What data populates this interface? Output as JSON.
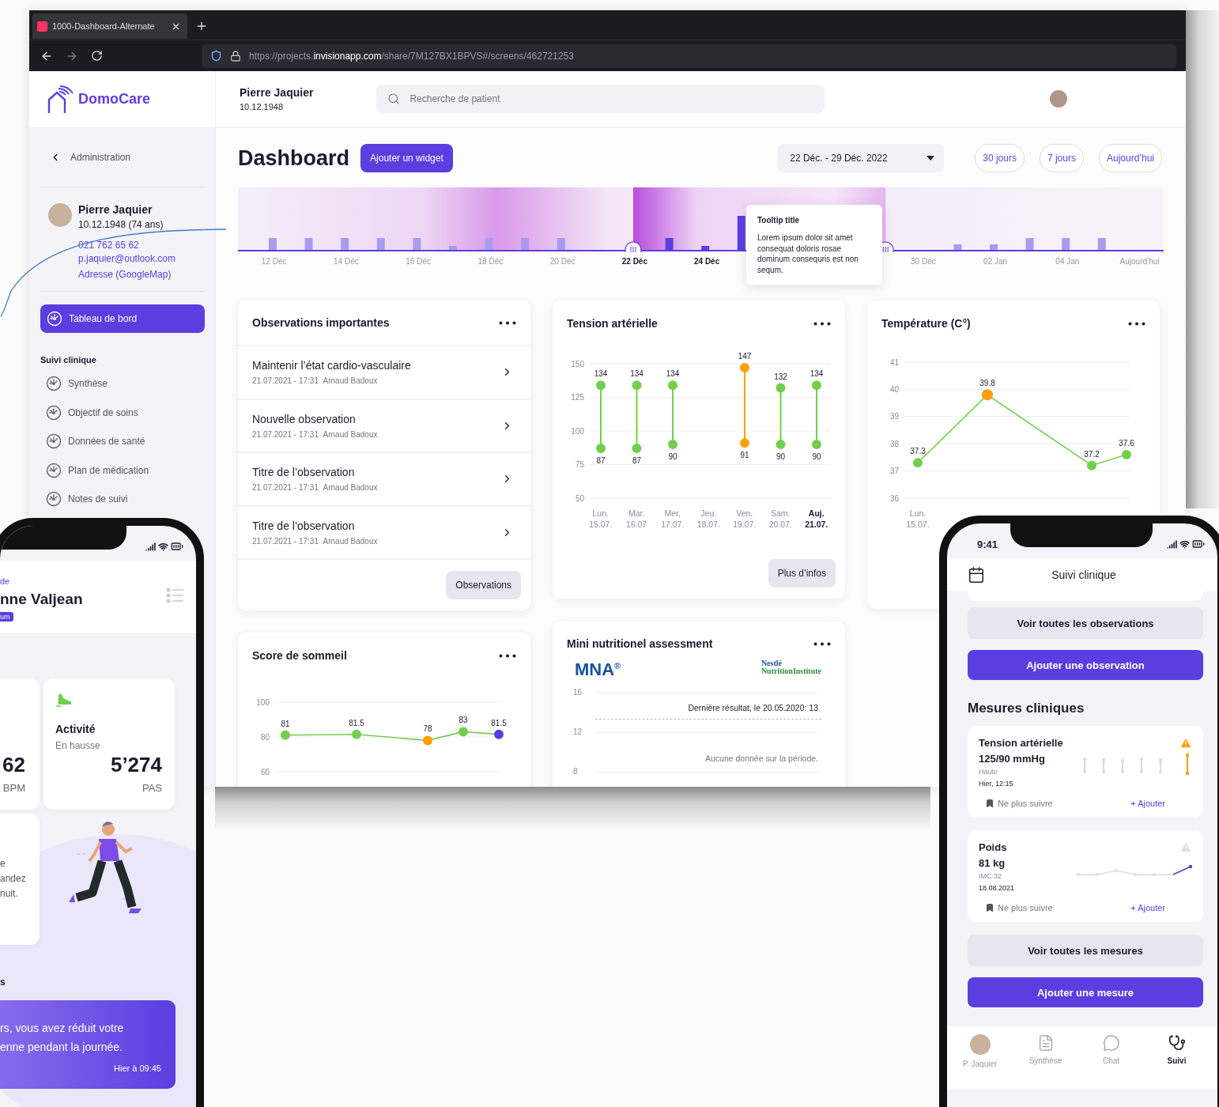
{
  "browser": {
    "tab_title": "1000-Dashboard-Alternate",
    "url": "https://projects.**invisionapp.com**/share/7M127BX1BPVS#/screens/462721253"
  },
  "header": {
    "logo": "DomoCare",
    "patient": {
      "name": "Pierre Jaquier",
      "birth": "10.12.1948"
    },
    "search": {
      "placeholder": "Recherche de patient"
    }
  },
  "sidebar": {
    "back": "Administration",
    "profile": {
      "name": "Pierre Jaquier",
      "birth": "10.12.1948 (74 ans)",
      "phone": "021 762 65 62",
      "email": "p.jaquier@outlook.com",
      "address": "Adresse (GoogleMap)"
    },
    "nav": [
      {
        "label": "Tableau de bord",
        "selected": true
      }
    ],
    "section": {
      "title": "Suivi clinique",
      "items": [
        {
          "label": "Synthèse",
          "selected": false
        },
        {
          "label": "Objectif de soins",
          "selected": false
        },
        {
          "label": "Données de santé",
          "selected": false
        },
        {
          "label": "Plan de médication",
          "selected": false
        },
        {
          "label": "Notes de suivi",
          "selected": false
        }
      ]
    }
  },
  "dashboard": {
    "title": "Dashboard",
    "add_widget": "Ajouter un widget",
    "date_range": "22 Déc. - 29 Déc. 2022",
    "quick_ranges": [
      "30 jours",
      "7 jours",
      "Aujourd’hui"
    ]
  },
  "timeline": {
    "labels": [
      {
        "text": "12 Déc",
        "in_range": false
      },
      {
        "text": "14 Déc",
        "in_range": false
      },
      {
        "text": "16 Déc",
        "in_range": false
      },
      {
        "text": "18 Déc",
        "in_range": false
      },
      {
        "text": "20 Déc",
        "in_range": false
      },
      {
        "text": "22 Déc",
        "in_range": true
      },
      {
        "text": "24 Déc",
        "in_range": true
      },
      {
        "text": "30 Déc",
        "in_range": false
      },
      {
        "text": "02 Jan",
        "in_range": false
      },
      {
        "text": "04 Jan",
        "in_range": false
      },
      {
        "text": "Aujourd’hui",
        "in_range": false
      }
    ],
    "tooltip": {
      "title": "Tooltip title",
      "body": "Lorem ipsum dolor sit amet consequat doloris rosae dominum consequris est non sequm."
    }
  },
  "observations": {
    "title": "Observations importantes",
    "items": [
      {
        "title": "Maintenir l’état cardio-vasculaire",
        "date": "21.07.2021 - 17:31",
        "author": "Arnaud Badoux"
      },
      {
        "title": "Nouvelle observation",
        "date": "21.07.2021 - 17:31",
        "author": "Arnaud Badoux"
      },
      {
        "title": "Titre de l’observation",
        "date": "21.07.2021 - 17:31",
        "author": "Arnaud Badoux"
      },
      {
        "title": "Titre de l’observation",
        "date": "21.07.2021 - 17:31",
        "author": "Arnaud Badoux"
      }
    ],
    "button": "Observations"
  },
  "tension": {
    "title": "Tension artérielle",
    "chart_data": {
      "type": "scatter",
      "categories": [
        "Lun. 15.07.",
        "Mar. 16.07",
        "Mer. 17.07.",
        "Jeu. 18.07.",
        "Ven. 19.07.",
        "Sam. 20.07.",
        "Auj. 21.07."
      ],
      "series": [
        {
          "color": "#72cf4c",
          "values": [
            134,
            134,
            134,
            null,
            null,
            132,
            134
          ]
        },
        {
          "color": "#72cf4c",
          "values": [
            87,
            87,
            90,
            null,
            null,
            90,
            90
          ]
        },
        {
          "color": "#ff9f0a",
          "values": [
            null,
            null,
            null,
            null,
            147,
            null,
            null
          ]
        },
        {
          "color": "#ff9f0a",
          "values": [
            null,
            null,
            null,
            null,
            91,
            null,
            null
          ]
        }
      ],
      "ylim": [
        50,
        150
      ],
      "yticks": [
        50,
        75,
        100,
        125,
        150
      ],
      "grid": true,
      "data_labels": true
    },
    "today": [
      false,
      false,
      false,
      false,
      false,
      false,
      true
    ],
    "button": "Plus d’infos"
  },
  "temperature": {
    "title": "Température (C°)",
    "chart_data": {
      "type": "line",
      "categories": [
        "Lun. 15.07.",
        null,
        null,
        null,
        null,
        null,
        null
      ],
      "values": [
        37.3,
        null,
        39.8,
        null,
        null,
        37.2,
        37.6
      ],
      "ylim": [
        36,
        41
      ],
      "yticks": [
        36,
        37,
        38,
        39,
        40,
        41
      ],
      "grid": true,
      "marker": true,
      "data_labels": true
    },
    "alerts": [
      false,
      true,
      false,
      false
    ]
  },
  "sleep": {
    "title": "Score de sommeil",
    "chart_data": {
      "type": "line",
      "categories": [
        null,
        null,
        null,
        null,
        null,
        null,
        null
      ],
      "values": [
        81,
        null,
        81.5,
        null,
        78,
        83,
        81.5
      ],
      "ylim": [
        60,
        100
      ],
      "yticks": [
        60,
        80,
        100
      ],
      "grid": true,
      "marker": true,
      "data_labels": true
    },
    "points": [
      {
        "color": "#72cf4c"
      },
      {
        "color": "#72cf4c"
      },
      {
        "color": "#ff9f0a"
      },
      {
        "color": "#72cf4c"
      },
      {
        "color": "#5a3ee0"
      }
    ]
  },
  "mna": {
    "title": "Mini nutritionel assessment",
    "logo": "MNA$^{®}$",
    "partner_logo": [
      "Nestlé",
      "NutritionInstitute"
    ],
    "yticks": [
      "16",
      "12",
      "8"
    ],
    "last_result": "Dernière résultat, le 20.05.2020: 13",
    "empty": "Aucune donnée sur la période."
  },
  "mobile_left": {
    "overline": "de",
    "name": "nne Valjean",
    "badge": "um",
    "heart": {
      "value": "62",
      "unit": "BPM"
    },
    "activity": {
      "title": "Activité",
      "subtitle": "En hausse",
      "value": "5’274",
      "unit": "PAS"
    },
    "tip_lines": [
      "e",
      "andez",
      "nuit."
    ],
    "section": "s",
    "message": {
      "lines": [
        "rs, vous avez réduit votre",
        "enne pendant la journée."
      ],
      "time": "Hier à 09:45"
    }
  },
  "mobile_right": {
    "time": "9:41",
    "title": "Suivi clinique",
    "see_observations": "Voir toutes les observations",
    "add_observation": "Ajouter une observation",
    "section": "Mesures cliniques",
    "measures": [
      {
        "kind": "range",
        "title": "Tension artérielle",
        "value": "125/90 mmHg",
        "note": "Haute",
        "date": "Hier, 12:15",
        "alert": true,
        "unfollow": "Ne plus suivre",
        "add": "+ Ajouter"
      },
      {
        "kind": "trend",
        "title": "Poids",
        "value": "81 kg",
        "note": "IMC 32",
        "date": "18.08.2021",
        "alert": false,
        "unfollow": "Ne plus suivre",
        "add": "+ Ajouter"
      }
    ],
    "see_measures": "Voir toutes les mesures",
    "add_measure": "Ajouter une mesure",
    "tabs": [
      {
        "kind": "avatar",
        "label": "P. Jaquier",
        "selected": false
      },
      {
        "kind": "document",
        "label": "Synthèse",
        "selected": false
      },
      {
        "kind": "chat",
        "label": "Chat",
        "selected": false
      },
      {
        "kind": "stethoscope",
        "label": "Suivi",
        "selected": true
      }
    ]
  }
}
